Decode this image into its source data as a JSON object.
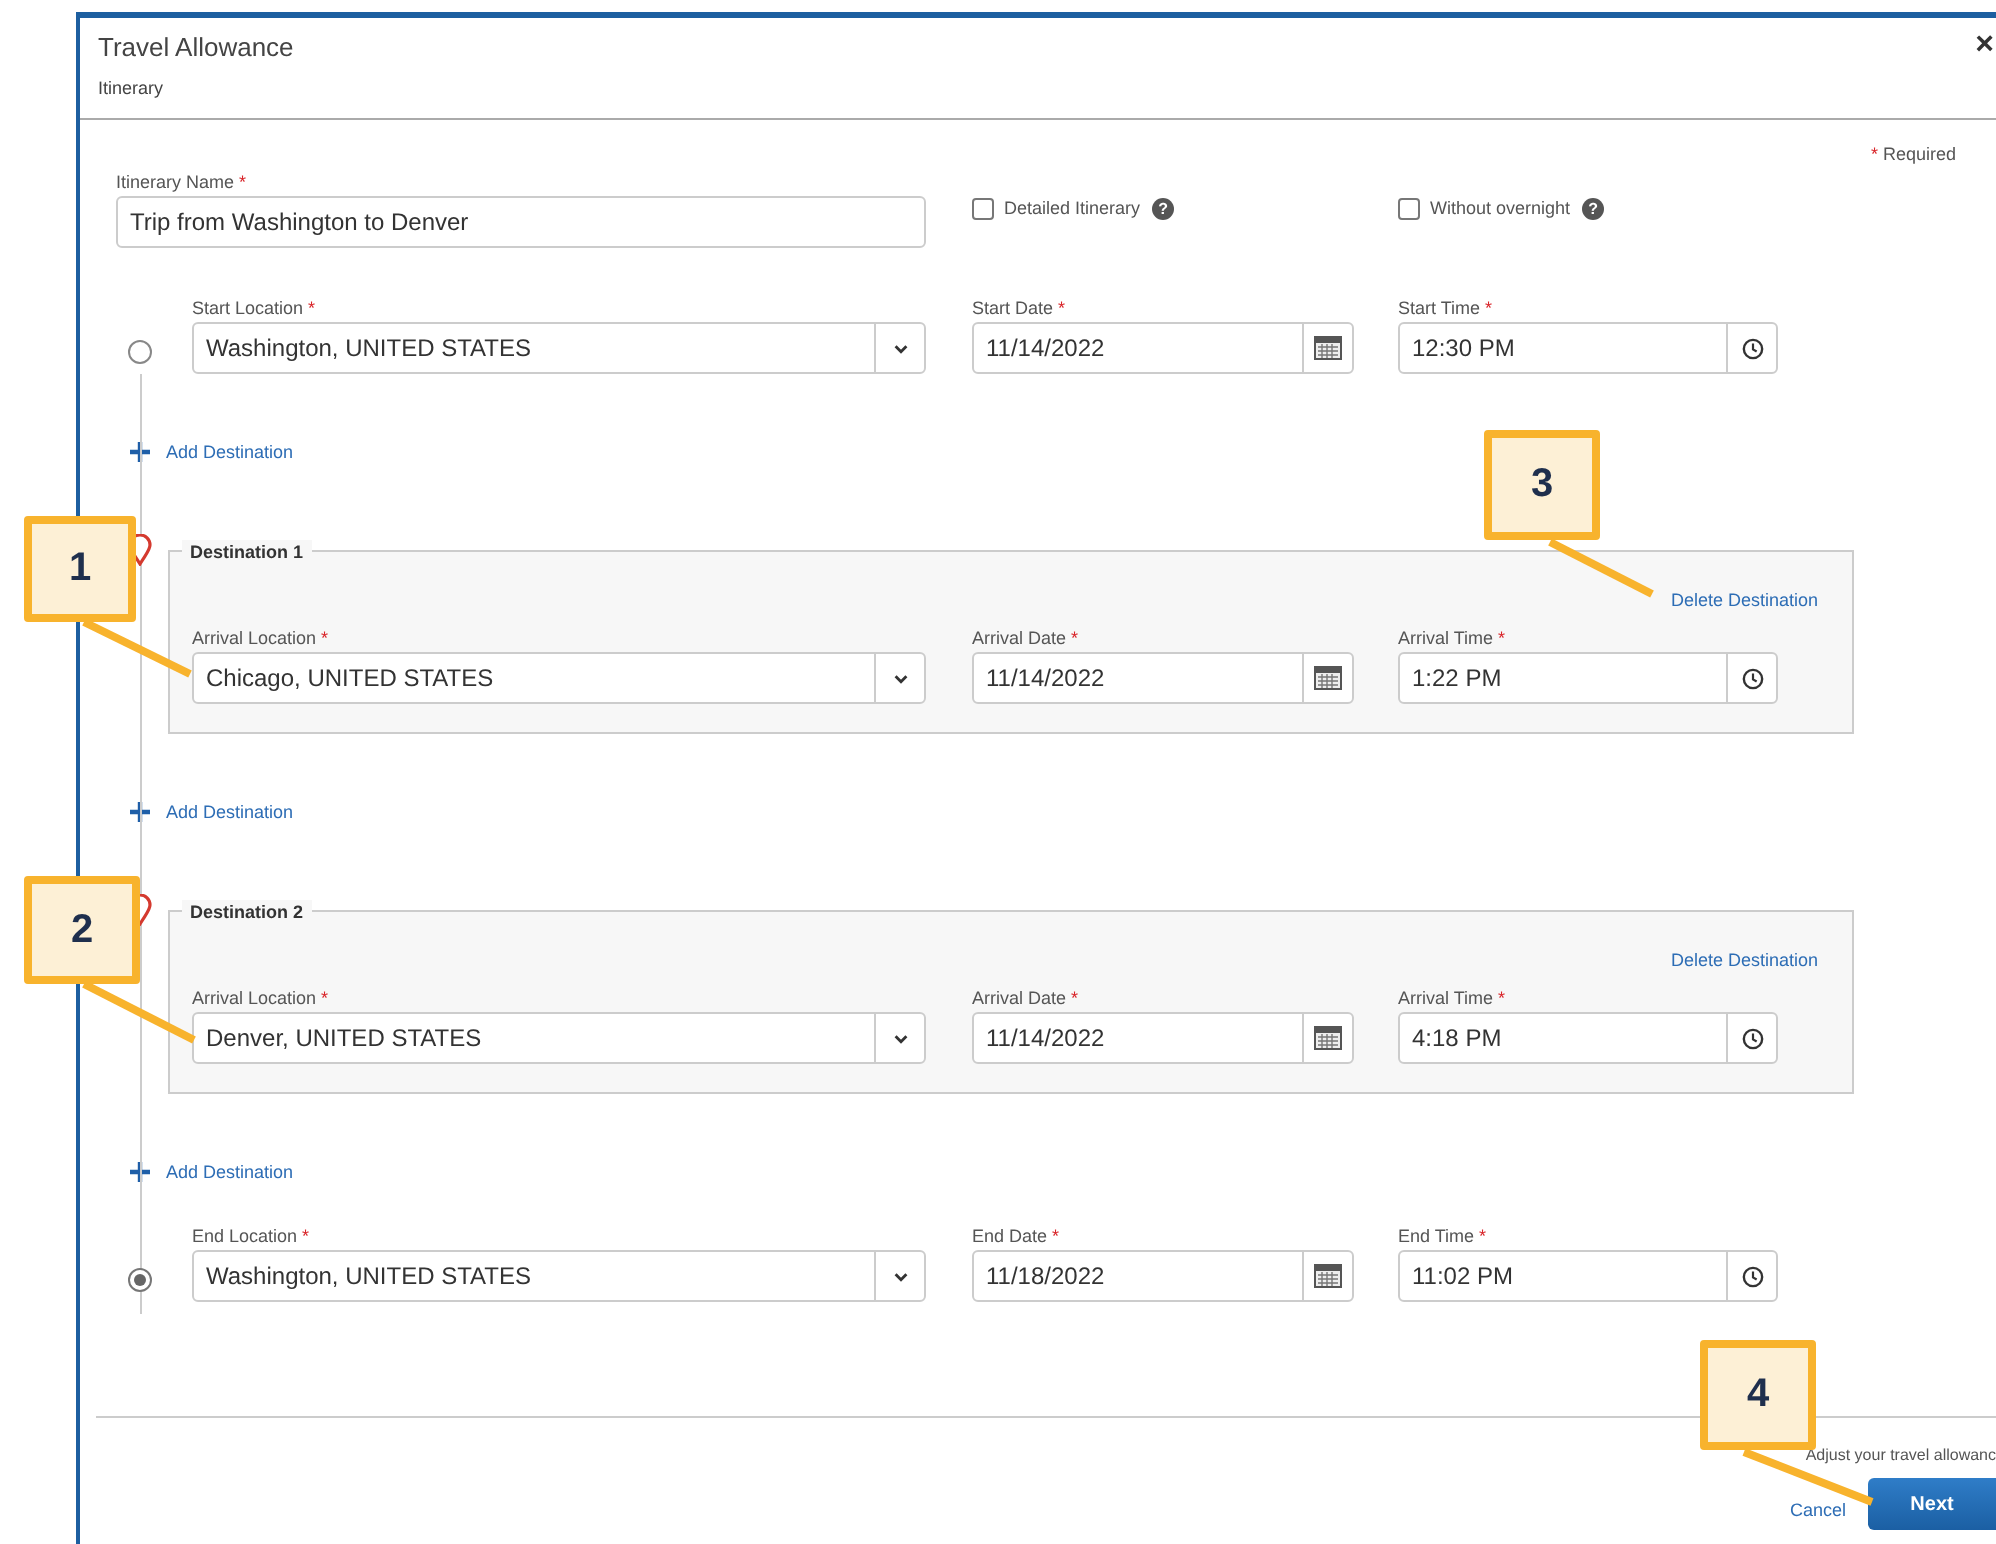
{
  "dialog": {
    "title": "Travel Allowance",
    "subtitle": "Itinerary",
    "close": "×"
  },
  "required_note": {
    "mark": "*",
    "text": "Required"
  },
  "itinerary_name": {
    "label": "Itinerary Name",
    "mark": "*",
    "value": "Trip from Washington to Denver"
  },
  "options": [
    {
      "label": "Detailed Itinerary",
      "checked": false,
      "help": "?"
    },
    {
      "label": "Without overnight",
      "checked": false,
      "help": "?"
    }
  ],
  "stops": [
    {
      "kind": "endpoint",
      "selected": false,
      "fields": [
        {
          "kind": "select",
          "label": "Start Location",
          "mark": "*",
          "value": "Washington, UNITED STATES"
        },
        {
          "kind": "date",
          "label": "Start Date",
          "mark": "*",
          "value": "11/14/2022"
        },
        {
          "kind": "time",
          "label": "Start Time",
          "mark": "*",
          "value": "12:30 PM"
        }
      ]
    },
    {
      "kind": "add",
      "label": "Add Destination"
    },
    {
      "kind": "destination",
      "title": "Destination 1",
      "delete": "Delete Destination",
      "fields": [
        {
          "kind": "select",
          "label": "Arrival Location",
          "mark": "*",
          "value": "Chicago, UNITED STATES"
        },
        {
          "kind": "date",
          "label": "Arrival Date",
          "mark": "*",
          "value": "11/14/2022"
        },
        {
          "kind": "time",
          "label": "Arrival Time",
          "mark": "*",
          "value": "1:22 PM"
        }
      ]
    },
    {
      "kind": "add",
      "label": "Add Destination"
    },
    {
      "kind": "destination",
      "title": "Destination 2",
      "delete": "Delete Destination",
      "fields": [
        {
          "kind": "select",
          "label": "Arrival Location",
          "mark": "*",
          "value": "Denver, UNITED STATES"
        },
        {
          "kind": "date",
          "label": "Arrival Date",
          "mark": "*",
          "value": "11/14/2022"
        },
        {
          "kind": "time",
          "label": "Arrival Time",
          "mark": "*",
          "value": "4:18 PM"
        }
      ]
    },
    {
      "kind": "add",
      "label": "Add Destination"
    },
    {
      "kind": "endpoint",
      "selected": true,
      "fields": [
        {
          "kind": "select",
          "label": "End Location",
          "mark": "*",
          "value": "Washington, UNITED STATES"
        },
        {
          "kind": "date",
          "label": "End Date",
          "mark": "*",
          "value": "11/18/2022"
        },
        {
          "kind": "time",
          "label": "End Time",
          "mark": "*",
          "value": "11:02 PM"
        }
      ]
    }
  ],
  "footer": {
    "hint": "Adjust your travel allowanc",
    "buttons": [
      {
        "kind": "link",
        "label": "Cancel"
      },
      {
        "kind": "primary",
        "label": "Next"
      }
    ]
  },
  "callouts": [
    {
      "number": "1"
    },
    {
      "number": "2"
    },
    {
      "number": "3"
    },
    {
      "number": "4"
    }
  ]
}
